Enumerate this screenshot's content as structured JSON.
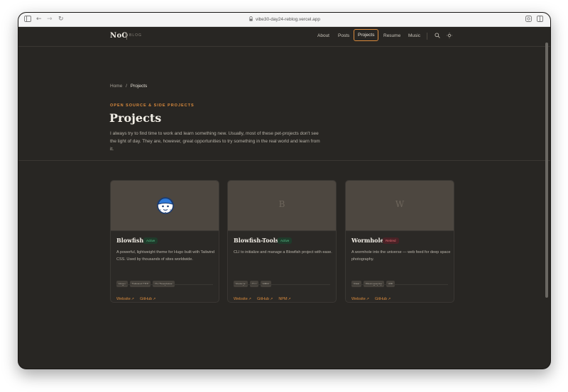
{
  "browser": {
    "url": "vibe30-day24-reblog.vercel.app",
    "icons": [
      "sidebar-icon",
      "back-icon",
      "forward-icon",
      "reload-icon",
      "lock-icon",
      "shield-icon",
      "tabs-icon"
    ]
  },
  "site": {
    "logo": "NoO",
    "logo_tag": "BLOG",
    "nav": [
      {
        "label": "About"
      },
      {
        "label": "Posts"
      },
      {
        "label": "Projects"
      },
      {
        "label": "Resume"
      },
      {
        "label": "Music"
      }
    ],
    "nav_icons": [
      "search-icon",
      "theme-toggle-icon"
    ]
  },
  "breadcrumb": {
    "home": "Home",
    "sep": "/",
    "current": "Projects"
  },
  "hero": {
    "eyebrow": "OPEN SOURCE & SIDE PROJECTS",
    "title": "Projects",
    "intro": "I always try to find time to work and learn something new. Usually, most of these pet-projects don't see the light of day. They are, however, great opportunities to try something in the real world and learn from it."
  },
  "projects": [
    {
      "title": "Blowfish",
      "badge": "Active",
      "desc": "A powerful, lightweight theme for Hugo built with Tailwind CSS. Used by thousands of sites worldwide.",
      "tags": [
        "Hugo",
        "Tailwind CSS",
        "Go Templates"
      ],
      "links": [
        "Website",
        "GitHub"
      ]
    },
    {
      "title": "Blowfish-Tools",
      "media_letter": "B",
      "badge": "Active",
      "desc": "CLI to initialize and manage a Blowfish project with ease.",
      "tags": [
        "Node.js",
        "CLI",
        "NPM"
      ],
      "links": [
        "Website",
        "GitHub",
        "NPM"
      ]
    },
    {
      "title": "Wormhole",
      "media_letter": "W",
      "badge": "Retired",
      "desc": "A wormhole into the universe — web feed for deep space photography.",
      "tags": [
        "Web",
        "Photography",
        "API"
      ],
      "links": [
        "Website",
        "GitHub"
      ]
    }
  ],
  "colors": {
    "accent": "#d98a3d",
    "background": "#282623",
    "active_badge": "#58c08a",
    "retired_badge": "#e46d73"
  }
}
